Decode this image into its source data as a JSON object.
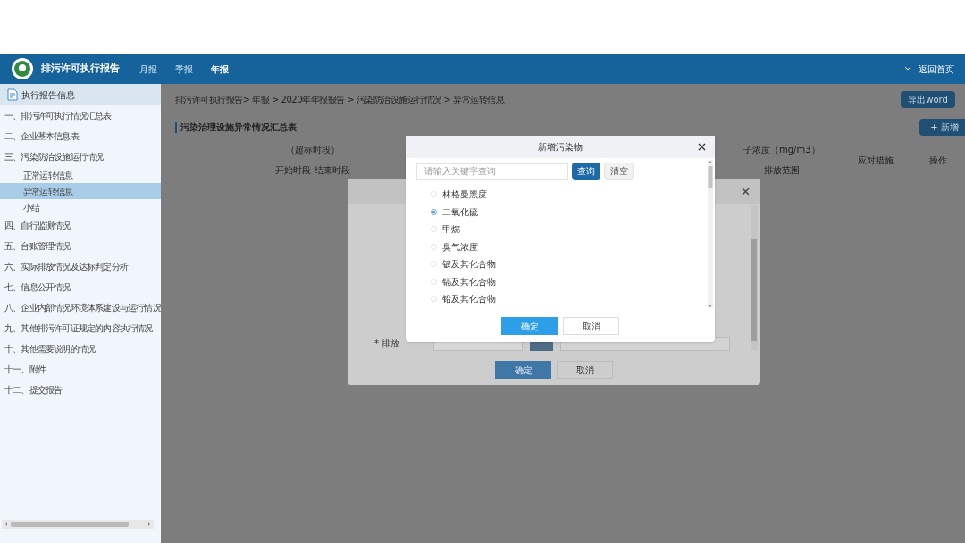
{
  "header": {
    "title": "排污许可执行报告",
    "nav": [
      {
        "label": "月报",
        "selected": false
      },
      {
        "label": "季报",
        "selected": false
      },
      {
        "label": "年报",
        "selected": true
      }
    ],
    "home": "返回首页"
  },
  "sidebar": {
    "heading": "执行报告信息",
    "items": [
      {
        "label": "一、排污许可执行情况汇总表",
        "selected": false
      },
      {
        "label": "二、企业基本信息表",
        "selected": false
      },
      {
        "label": "三、污染防治设施运行情况",
        "selected": false,
        "children": [
          {
            "label": "正常运转信息",
            "selected": false
          },
          {
            "label": "异常运转信息",
            "selected": true
          },
          {
            "label": "小结",
            "selected": false
          }
        ]
      },
      {
        "label": "四、自行监测情况",
        "selected": false
      },
      {
        "label": "五、台账管理情况",
        "selected": false
      },
      {
        "label": "六、实际排放情况及达标判定分析",
        "selected": false
      },
      {
        "label": "七、信息公开情况",
        "selected": false
      },
      {
        "label": "八、企业内部情况环境体系建设与运行情况",
        "selected": false
      },
      {
        "label": "九、其他排污许可证规定的内容执行情况",
        "selected": false
      },
      {
        "label": "十、其他需要说明的情况",
        "selected": false
      },
      {
        "label": "十一、附件",
        "selected": false
      },
      {
        "label": "十二、提交报告",
        "selected": false
      }
    ]
  },
  "breadcrumb": "排污许可执行报告> 年报 > 2020年年报报告 > 污染防治设施运行情况 > 异常运转信息",
  "export_button": "导出word",
  "section_title": "污染治理设施异常情况汇总表",
  "add_button": "+ 新增",
  "table": {
    "columns": [
      {
        "lines": [
          "（超标时段）",
          "开始时段-结束时段"
        ]
      },
      {
        "lines": [
          "子浓度（mg/m3）",
          "排放范围"
        ]
      },
      {
        "lines": [
          "应对措施"
        ]
      },
      {
        "lines": [
          "操作"
        ]
      }
    ]
  },
  "back_dialog": {
    "field_label": "* 排放",
    "buttons": [
      "确定",
      "取消"
    ]
  },
  "modal": {
    "title": "新增污染物",
    "search": {
      "placeholder": "请输入关键字查询"
    },
    "search_button": "查询",
    "clear_button": "清空",
    "options": [
      {
        "label": "林格曼黑度",
        "selected": false
      },
      {
        "label": "二氧化硫",
        "selected": true
      },
      {
        "label": "甲烷",
        "selected": false
      },
      {
        "label": "臭气浓度",
        "selected": false
      },
      {
        "label": "铍及其化合物",
        "selected": false
      },
      {
        "label": "镉及其化合物",
        "selected": false
      },
      {
        "label": "铅及其化合物",
        "selected": false
      }
    ],
    "buttons": [
      "确定",
      "取消"
    ]
  }
}
